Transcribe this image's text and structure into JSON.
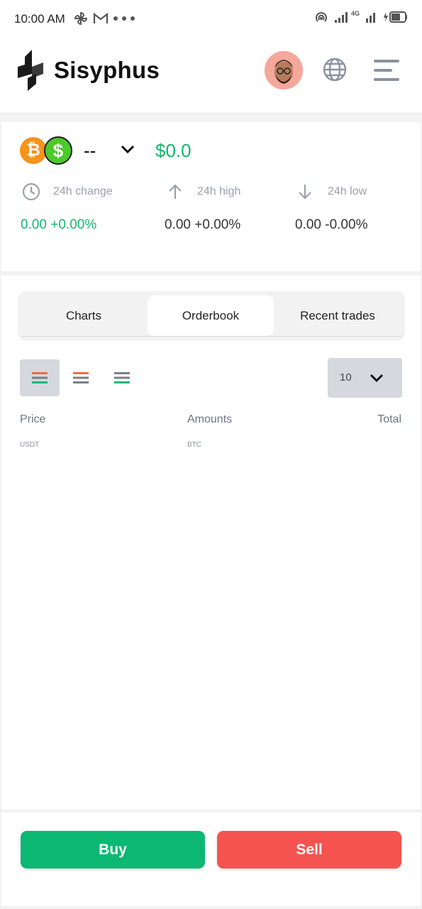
{
  "status_bar": {
    "time": "10:00 AM",
    "network": "4G"
  },
  "header": {
    "brand": "Sisyphus"
  },
  "ticker": {
    "pair": "--",
    "price": "$0.0",
    "stats": [
      {
        "label": "24h change",
        "value": "0.00 +0.00%",
        "icon": "clock-icon"
      },
      {
        "label": "24h high",
        "value": "0.00 +0.00%",
        "icon": "arrow-up-icon"
      },
      {
        "label": "24h low",
        "value": "0.00 -0.00%",
        "icon": "arrow-down-icon"
      }
    ]
  },
  "tabs": [
    {
      "label": "Charts",
      "active": false
    },
    {
      "label": "Orderbook",
      "active": true
    },
    {
      "label": "Recent trades",
      "active": false
    }
  ],
  "orderbook": {
    "depth": "10",
    "columns": [
      {
        "label": "Price",
        "unit": "USDT"
      },
      {
        "label": "Amounts",
        "unit": "BTC"
      },
      {
        "label": "Total",
        "unit": ""
      }
    ]
  },
  "actions": {
    "buy": "Buy",
    "sell": "Sell"
  },
  "colors": {
    "accent_green": "#0db873",
    "accent_red": "#f5534f",
    "text_muted": "#9aa1ab"
  }
}
